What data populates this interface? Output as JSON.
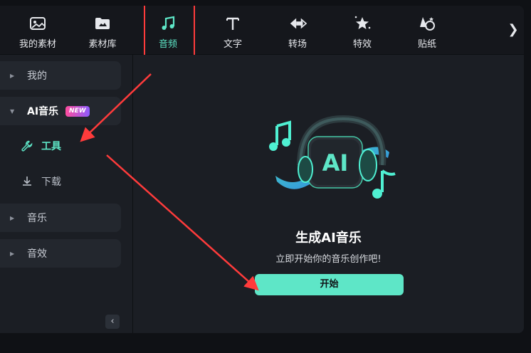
{
  "toolbar": {
    "items": [
      {
        "label": "我的素材",
        "icon": "my-media-icon"
      },
      {
        "label": "素材库",
        "icon": "media-library-icon"
      },
      {
        "label": "音频",
        "icon": "music-note-icon"
      },
      {
        "label": "文字",
        "icon": "text-icon"
      },
      {
        "label": "转场",
        "icon": "transition-icon"
      },
      {
        "label": "特效",
        "icon": "effects-icon"
      },
      {
        "label": "贴纸",
        "icon": "sticker-icon"
      }
    ],
    "active_index": 2,
    "more_glyph": "❯"
  },
  "sidebar": {
    "mine": "我的",
    "ai_music": "AI音乐",
    "new_badge": "NEW",
    "tools": "工具",
    "download": "下载",
    "music": "音乐",
    "sfx": "音效",
    "collapse_glyph": "‹"
  },
  "main": {
    "title": "生成AI音乐",
    "subtitle": "立即开始你的音乐创作吧!",
    "start_label": "开始",
    "hero_text": "AI"
  },
  "colors": {
    "accent": "#5ee6c7",
    "annotation": "#ff3b3b",
    "badge_from": "#ff4d9e",
    "badge_to": "#8d5bff"
  }
}
